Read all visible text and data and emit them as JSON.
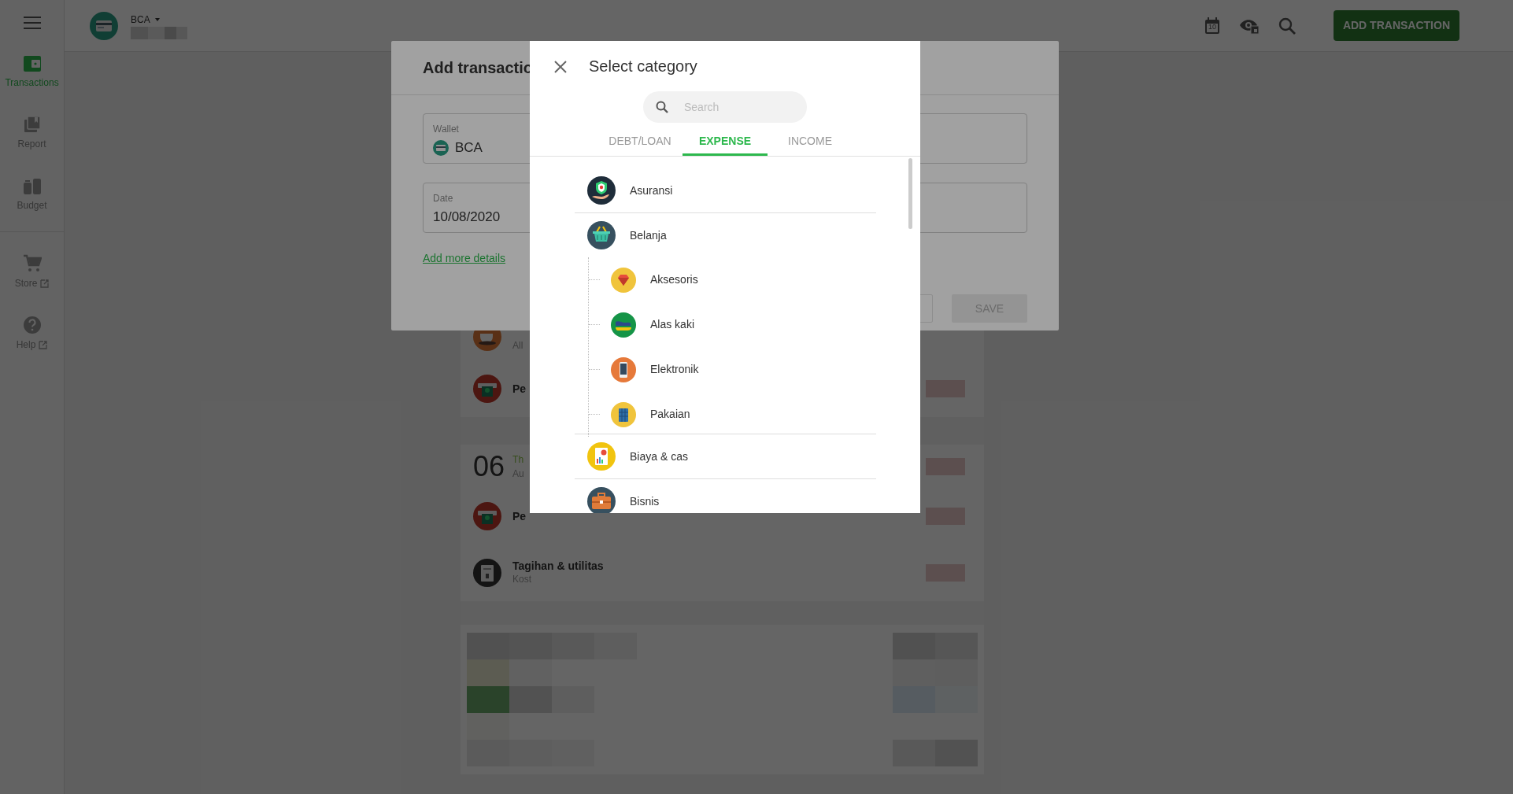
{
  "sidebar": {
    "items": [
      {
        "label": "Transactions",
        "selected": true,
        "external": false
      },
      {
        "label": "Report",
        "selected": false,
        "external": false
      },
      {
        "label": "Budget",
        "selected": false,
        "external": false
      },
      {
        "label": "Store",
        "selected": false,
        "external": true
      },
      {
        "label": "Help",
        "selected": false,
        "external": true
      }
    ]
  },
  "header": {
    "wallet": "BCA",
    "calendar_day": "10",
    "action": "ADD TRANSACTION"
  },
  "transactions": {
    "rows": [
      {
        "kind": "entry",
        "note": "All"
      },
      {
        "kind": "entry",
        "title": "Pe"
      },
      {
        "kind": "date",
        "day": "06",
        "weekday": "Th",
        "month": "Au"
      },
      {
        "kind": "entry",
        "title": "Pe"
      },
      {
        "kind": "entry",
        "title": "Tagihan & utilitas",
        "note": "Kost"
      }
    ]
  },
  "add_dialog": {
    "title": "Add transactio",
    "wallet_label": "Wallet",
    "wallet": "BCA",
    "date_label": "Date",
    "date": "10/08/2020",
    "link": "Add more details",
    "save": "SAVE",
    "save_disabled": true
  },
  "category_dialog": {
    "title": "Select category",
    "search": {
      "placeholder": "Search"
    },
    "tabs": [
      {
        "label": "DEBT/LOAN",
        "selected": false
      },
      {
        "label": "EXPENSE",
        "selected": true
      },
      {
        "label": "INCOME",
        "selected": false
      }
    ],
    "categories": [
      {
        "name": "Asuransi"
      },
      {
        "name": "Belanja",
        "children": [
          {
            "name": "Aksesoris"
          },
          {
            "name": "Alas kaki"
          },
          {
            "name": "Elektronik"
          },
          {
            "name": "Pakaian"
          }
        ]
      },
      {
        "name": "Biaya & cas"
      },
      {
        "name": "Bisnis"
      }
    ]
  }
}
